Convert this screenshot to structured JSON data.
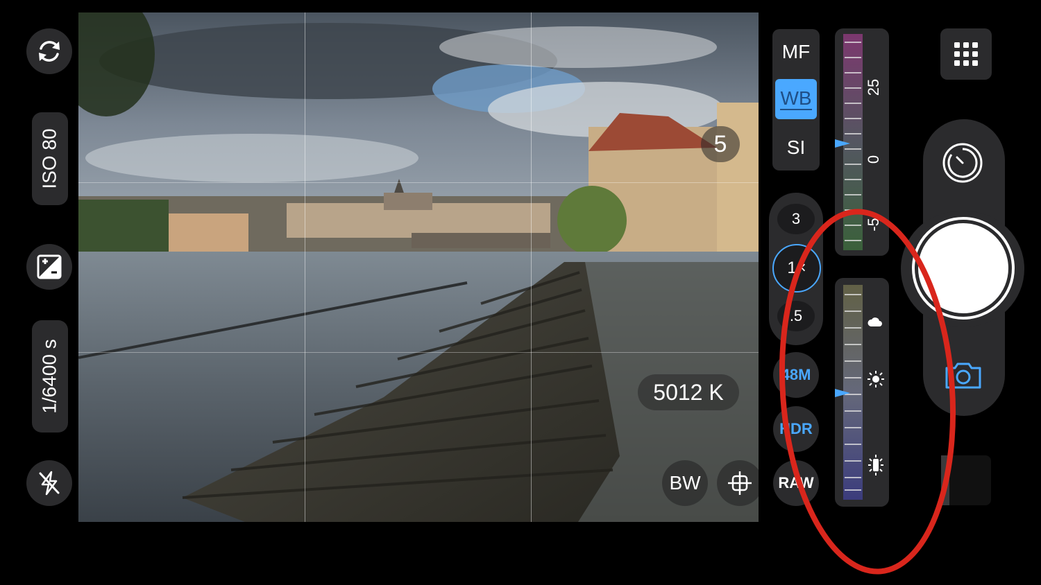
{
  "left_rail": {
    "iso_label": "ISO 80",
    "shutter_label": "1/6400 s",
    "icons": [
      "flip-camera-icon",
      "exposure-compensation-icon",
      "flash-off-icon"
    ]
  },
  "viewfinder": {
    "focus_badge": "5",
    "wb_readout": "5012 K",
    "bw_label": "BW",
    "level_icon": "level-crosshair-icon"
  },
  "modes": {
    "mf_label": "MF",
    "wb_label": "WB",
    "si_label": "SI",
    "active": "WB"
  },
  "zoom": {
    "options": [
      "3",
      "1×",
      ".5"
    ],
    "active": "1×"
  },
  "format_buttons": {
    "resolution_label": "48M",
    "hdr_label": "HDR",
    "raw_label": "RAW"
  },
  "tint_slider": {
    "label_25": "25",
    "label_0": "0",
    "label_neg": "-5",
    "value": 0
  },
  "wb_slider": {
    "icons": [
      "cloudy-icon",
      "sunny-icon",
      "incandescent-icon"
    ],
    "value_kelvin": 5012
  },
  "capture": {
    "icons": [
      "timer-icon",
      "shutter-button",
      "camera-switch-icon",
      "app-grid-icon"
    ]
  },
  "annotation": {
    "color": "#d9261c"
  },
  "colors": {
    "accent": "#4aa8ff",
    "wb_active_bg": "#4aa8ff",
    "panel_bg": "#2b2b2d"
  }
}
